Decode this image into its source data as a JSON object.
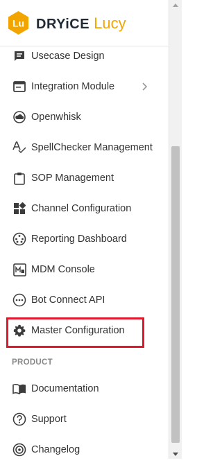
{
  "brand": {
    "badge": "Lu",
    "name": "DRYiCE",
    "product": "Lucy",
    "colors": {
      "badge": "#f2a500",
      "name": "#1f2a36",
      "product": "#f2a500"
    }
  },
  "menu": {
    "items": [
      {
        "label": "Usecase Design",
        "icon": "usecase-design-icon"
      },
      {
        "label": "Integration Module",
        "icon": "integration-module-icon",
        "has_submenu": true
      },
      {
        "label": "Openwhisk",
        "icon": "cloud-icon"
      },
      {
        "label": "SpellChecker Management",
        "icon": "spellcheck-icon"
      },
      {
        "label": "SOP Management",
        "icon": "clipboard-icon"
      },
      {
        "label": "Channel Configuration",
        "icon": "channel-config-icon"
      },
      {
        "label": "Reporting Dashboard",
        "icon": "reporting-dashboard-icon"
      },
      {
        "label": "MDM Console",
        "icon": "mdm-console-icon"
      },
      {
        "label": "Bot Connect API",
        "icon": "bot-connect-icon"
      },
      {
        "label": "Master Configuration",
        "icon": "gear-icon",
        "highlighted": true
      }
    ],
    "section_title": "PRODUCT",
    "product_items": [
      {
        "label": "Documentation",
        "icon": "book-icon"
      },
      {
        "label": "Support",
        "icon": "help-circle-icon"
      },
      {
        "label": "Changelog",
        "icon": "changelog-icon"
      }
    ]
  },
  "accent": {
    "highlight_border": "#e0182b"
  }
}
